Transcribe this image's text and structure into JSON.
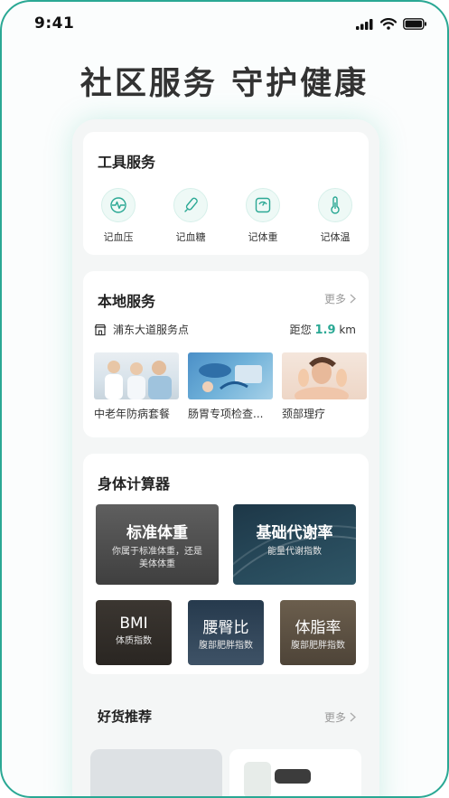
{
  "status_bar": {
    "time": "9:41"
  },
  "headline": "社区服务  守护健康",
  "tool_services": {
    "title": "工具服务",
    "items": [
      {
        "label": "记血压",
        "icon": "heart-rate-icon"
      },
      {
        "label": "记血糖",
        "icon": "glucose-pen-icon"
      },
      {
        "label": "记体重",
        "icon": "scale-icon"
      },
      {
        "label": "记体温",
        "icon": "thermometer-icon"
      }
    ]
  },
  "local_services": {
    "title": "本地服务",
    "more": "更多",
    "site_name": "浦东大道服务点",
    "distance_prefix": "距您",
    "distance_value": "1.9",
    "distance_unit": "km",
    "items": [
      {
        "label": "中老年防病套餐"
      },
      {
        "label": "肠胃专项检查..."
      },
      {
        "label": "颈部理疗"
      }
    ]
  },
  "body_calculator": {
    "title": "身体计算器",
    "large": [
      {
        "title": "标准体重",
        "subtitle_line1": "你属于标准体重，还是",
        "subtitle_line2": "美体体重"
      },
      {
        "title": "基础代谢率",
        "subtitle_line1": "能量代谢指数"
      }
    ],
    "small": [
      {
        "title": "BMI",
        "subtitle": "体质指数"
      },
      {
        "title": "腰臀比",
        "subtitle": "腹部肥胖指数"
      },
      {
        "title": "体脂率",
        "subtitle": "腹部肥胖指数"
      }
    ]
  },
  "recommend": {
    "title": "好货推荐",
    "more": "更多"
  },
  "colors": {
    "accent": "#2aa894",
    "distance": "#2aa894"
  }
}
